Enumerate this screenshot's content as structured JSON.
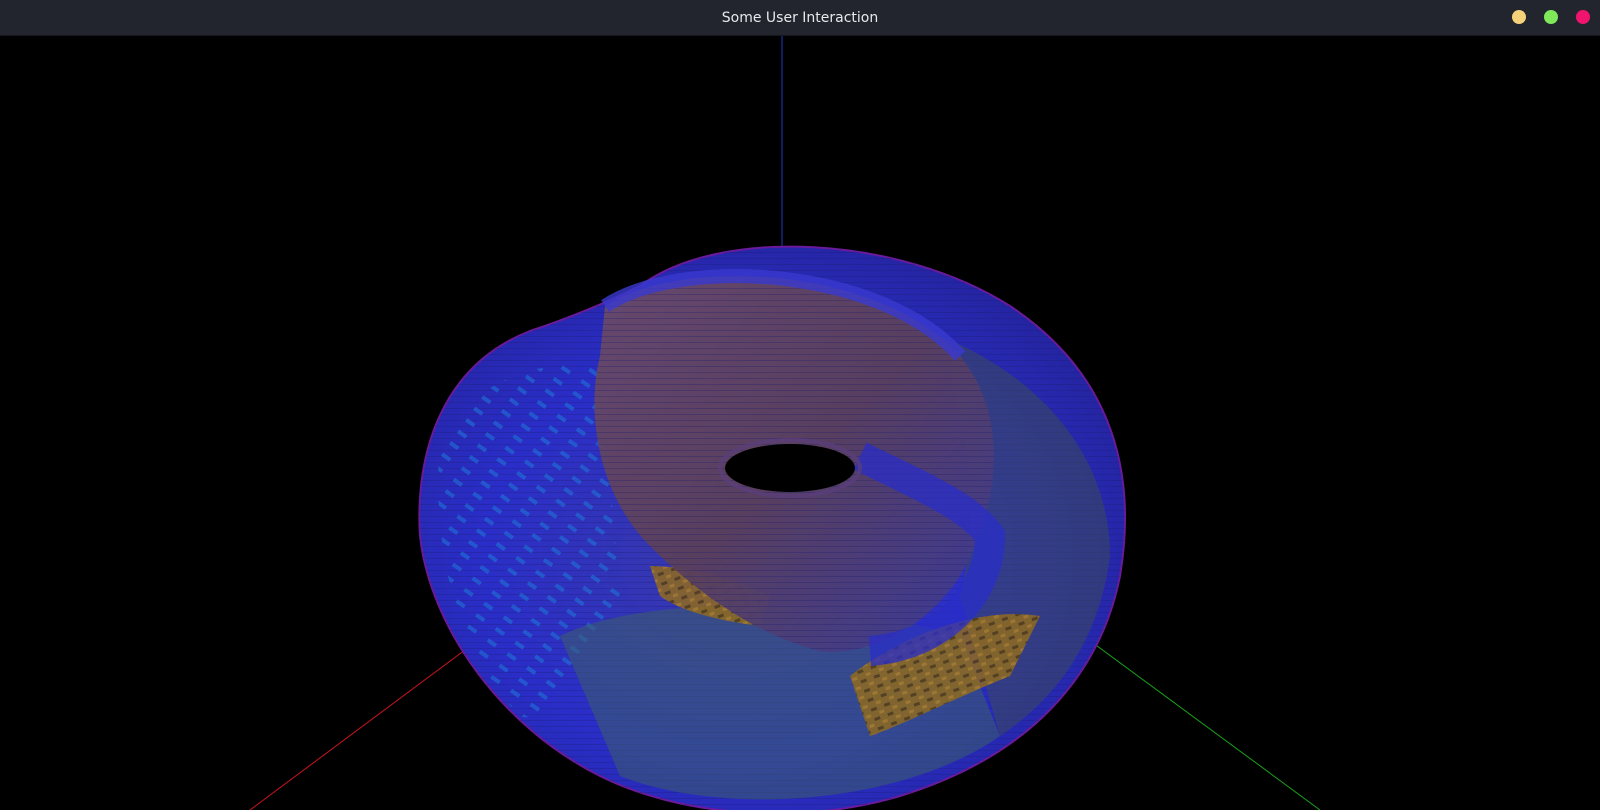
{
  "window": {
    "title": "Some User Interaction",
    "controls": [
      {
        "name": "minimize-button",
        "color": "#f5d27a"
      },
      {
        "name": "maximize-button",
        "color": "#7ee85a"
      },
      {
        "name": "close-button",
        "color": "#f0146e"
      }
    ]
  },
  "scene": {
    "background": "#000000",
    "axis_colors": {
      "x": "#c8141e",
      "y": "#1aa01a",
      "z": "#1e3cc8"
    },
    "surface_colors": [
      "#2a2ecf",
      "#5a4a86",
      "#1f6fd6",
      "#8f6a1e",
      "#3d5f6a",
      "#6a3a62"
    ]
  }
}
